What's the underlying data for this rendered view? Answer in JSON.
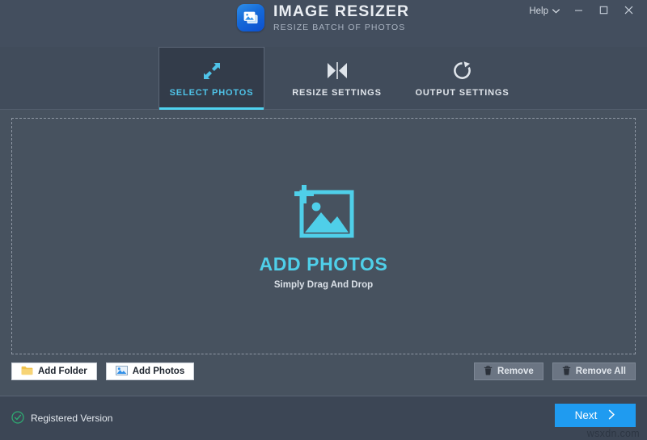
{
  "app": {
    "title": "IMAGE RESIZER",
    "subtitle": "RESIZE BATCH OF PHOTOS",
    "logo_icon": "photo-stack-icon"
  },
  "titlebar": {
    "help_label": "Help",
    "help_caret_icon": "chevron-down-icon",
    "minimize_icon": "minimize-icon",
    "maximize_icon": "maximize-icon",
    "close_icon": "close-icon"
  },
  "tabs": [
    {
      "id": "select",
      "label": "SELECT PHOTOS",
      "icon": "expand-arrows-icon",
      "active": true
    },
    {
      "id": "resize",
      "label": "RESIZE SETTINGS",
      "icon": "collapse-arrows-icon",
      "active": false
    },
    {
      "id": "output",
      "label": "OUTPUT SETTINGS",
      "icon": "refresh-circle-icon",
      "active": false
    }
  ],
  "dropzone": {
    "icon": "add-photo-icon",
    "title": "ADD PHOTOS",
    "subtitle": "Simply Drag And Drop"
  },
  "actions": {
    "add_folder": {
      "label": "Add Folder",
      "icon": "folder-icon"
    },
    "add_photos": {
      "label": "Add Photos",
      "icon": "photo-icon"
    },
    "remove": {
      "label": "Remove",
      "icon": "trash-icon"
    },
    "remove_all": {
      "label": "Remove All",
      "icon": "trash-icon"
    }
  },
  "footer": {
    "registered_label": "Registered Version",
    "registered_icon": "check-circle-icon",
    "next_label": "Next",
    "next_icon": "chevron-right-icon",
    "watermark": "wsxdn.com"
  },
  "colors": {
    "window_bg": "#434e5e",
    "content_bg": "#47525f",
    "accent_cyan": "#4fcfe9",
    "accent_blue": "#1f9bf0",
    "active_tab_bg": "#333c4a",
    "registered_green": "#2faa72"
  }
}
